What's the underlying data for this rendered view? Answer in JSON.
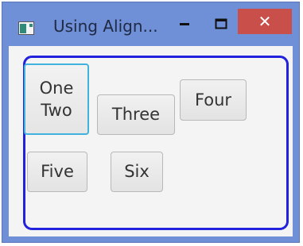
{
  "window": {
    "title": "Using Align...",
    "minimize_glyph": "—",
    "close_glyph": "✕",
    "frame_color": "#6f8fd6",
    "close_color": "#c9504a"
  },
  "pane": {
    "border_color": "#2222dd",
    "focus_color": "#3fb3dd"
  },
  "buttons": {
    "one_two": {
      "line1": "One",
      "line2": "Two"
    },
    "three": "Three",
    "four": "Four",
    "five": "Five",
    "six": "Six"
  }
}
